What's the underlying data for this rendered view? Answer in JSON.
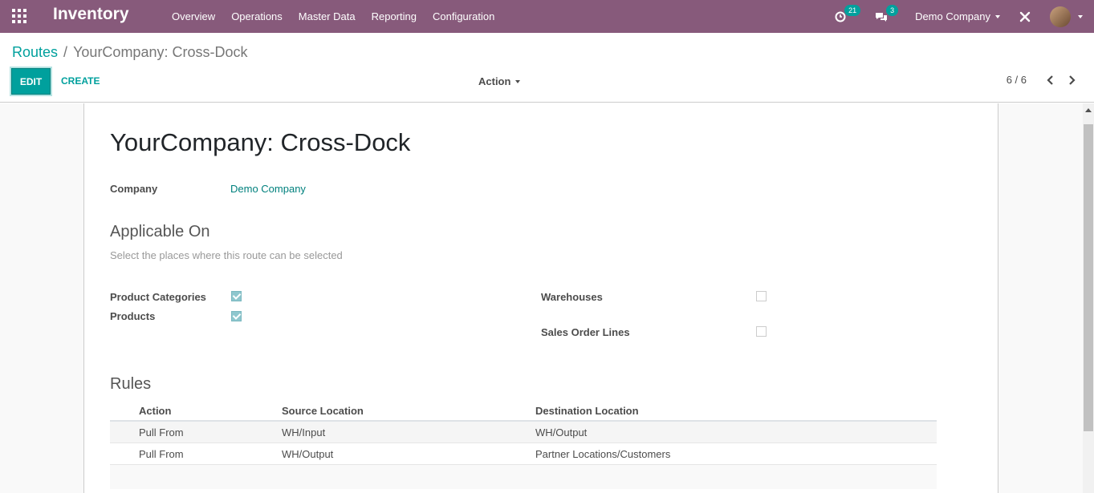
{
  "navbar": {
    "app_name": "Inventory",
    "menu": [
      "Overview",
      "Operations",
      "Master Data",
      "Reporting",
      "Configuration"
    ],
    "activity_count": "21",
    "messages_count": "3",
    "company": "Demo Company"
  },
  "breadcrumb": {
    "parent": "Routes",
    "separator": "/",
    "current": "YourCompany: Cross-Dock"
  },
  "toolbar": {
    "edit_label": "EDIT",
    "create_label": "CREATE",
    "action_label": "Action",
    "pager": "6 / 6"
  },
  "form": {
    "title": "YourCompany: Cross-Dock",
    "company_label": "Company",
    "company_value": "Demo Company",
    "applicable_heading": "Applicable On",
    "applicable_help": "Select the places where this route can be selected",
    "product_categories_label": "Product Categories",
    "product_categories_checked": true,
    "products_label": "Products",
    "products_checked": true,
    "warehouses_label": "Warehouses",
    "warehouses_checked": false,
    "sale_lines_label": "Sales Order Lines",
    "sale_lines_checked": false,
    "rules_heading": "Rules",
    "rules_columns": [
      "Action",
      "Source Location",
      "Destination Location"
    ],
    "rules": [
      {
        "action": "Pull From",
        "source": "WH/Input",
        "destination": "WH/Output"
      },
      {
        "action": "Pull From",
        "source": "WH/Output",
        "destination": "Partner Locations/Customers"
      }
    ]
  },
  "colors": {
    "navbar": "#875a7b",
    "accent": "#00a09d"
  }
}
